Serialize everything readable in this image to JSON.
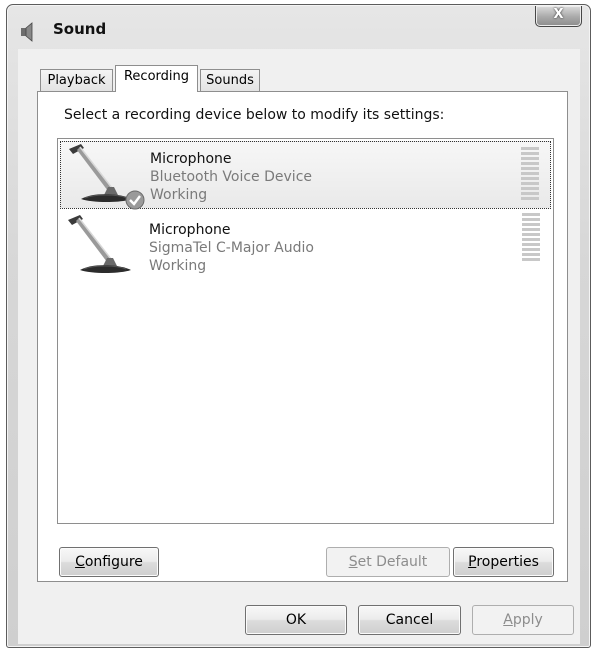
{
  "window": {
    "title": "Sound",
    "close_label": "X"
  },
  "tabs": [
    {
      "label": "Playback"
    },
    {
      "label": "Recording"
    },
    {
      "label": "Sounds"
    }
  ],
  "instruction": "Select a recording device below to modify its settings:",
  "devices": [
    {
      "name": "Microphone",
      "description": "Bluetooth Voice Device",
      "status": "Working"
    },
    {
      "name": "Microphone",
      "description": "SigmaTel C-Major Audio",
      "status": "Working"
    }
  ],
  "panel_buttons": {
    "configure": {
      "mnemonic": "C",
      "rest": "onfigure"
    },
    "set_default": {
      "mnemonic": "S",
      "rest": "et Default"
    },
    "properties": {
      "mnemonic": "P",
      "rest": "roperties"
    }
  },
  "dialog_buttons": {
    "ok": "OK",
    "cancel": "Cancel",
    "apply": {
      "mnemonic": "A",
      "rest": "pply"
    }
  },
  "icons": {
    "window": "speaker-icon",
    "device": "microphone-icon",
    "default_badge": "checkmark-icon"
  },
  "colors": {
    "selected_row": "#ececec",
    "disabled_text": "#8d8d8d"
  }
}
